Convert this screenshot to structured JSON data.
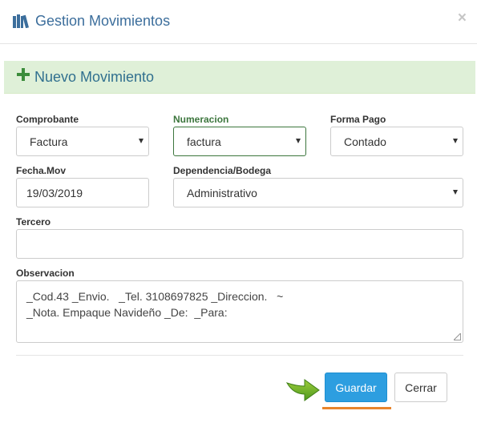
{
  "header": {
    "title": "Gestion Movimientos",
    "close_label": "×"
  },
  "section": {
    "title": "Nuevo Movimiento"
  },
  "form": {
    "comprobante": {
      "label": "Comprobante",
      "value": "Factura"
    },
    "numeracion": {
      "label": "Numeracion",
      "value": "factura"
    },
    "forma_pago": {
      "label": "Forma Pago",
      "value": "Contado"
    },
    "fecha_mov": {
      "label": "Fecha.Mov",
      "value": "19/03/2019"
    },
    "dependencia": {
      "label": "Dependencia/Bodega",
      "value": "Administrativo"
    },
    "tercero": {
      "label": "Tercero",
      "value": ""
    },
    "observacion": {
      "label": "Observacion",
      "line1": "_Cod.43 _Envio.   _Tel. 3108697825 _Direccion.   ~",
      "line2": "_Nota. Empaque Navideño _De:  _Para:"
    }
  },
  "footer": {
    "save_label": "Guardar",
    "close_label": "Cerrar"
  },
  "colors": {
    "accent": "#2d9ee0",
    "header_text": "#3c6e9c",
    "success_bg": "#dff0d8",
    "highlight": "#e8842c"
  },
  "icons": {
    "title": "books-icon",
    "section": "plus-icon",
    "pointer": "arrow-right-icon"
  }
}
